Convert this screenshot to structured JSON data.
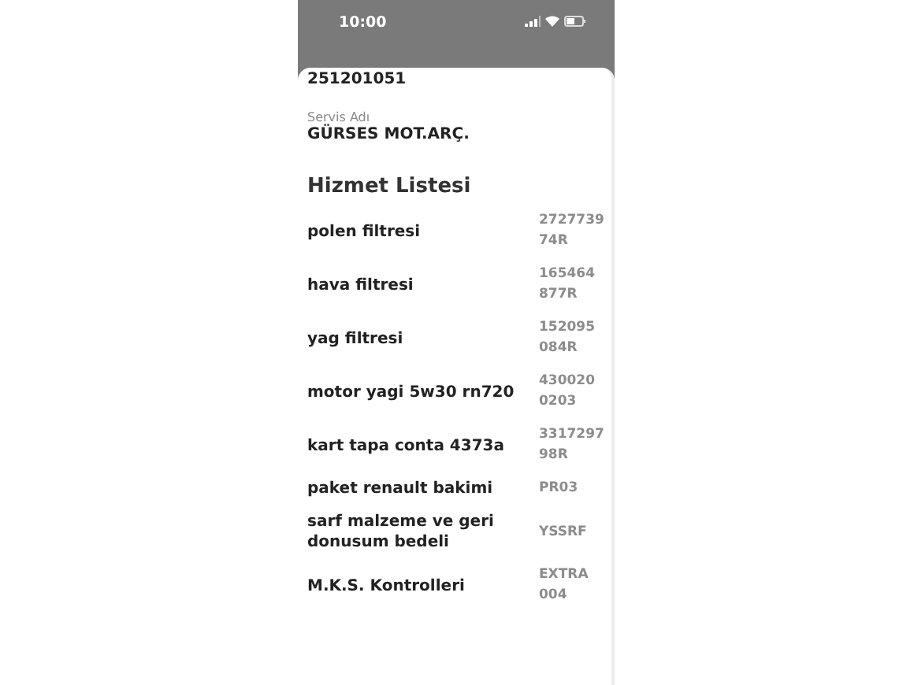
{
  "status_bar": {
    "time": "10:00"
  },
  "record_number": "251201051",
  "service": {
    "label": "Servis Adı",
    "value": "GÜRSES MOT.ARÇ."
  },
  "services_heading": "Hizmet Listesi",
  "services": [
    {
      "name": "polen filtresi",
      "code": "2727739 74R"
    },
    {
      "name": "hava filtresi",
      "code": "165464 877R"
    },
    {
      "name": "yag filtresi",
      "code": "152095 084R"
    },
    {
      "name": "motor yagi 5w30 rn720",
      "code": "430020 0203"
    },
    {
      "name": "kart tapa conta  4373a",
      "code": "3317297 98R"
    },
    {
      "name": "paket renault bakimi",
      "code": "PR03"
    },
    {
      "name": "sarf malzeme ve geri donusum bedeli",
      "code": "YSSRF"
    },
    {
      "name": "M.K.S. Kontrolleri",
      "code": "EXTRA 004"
    }
  ]
}
